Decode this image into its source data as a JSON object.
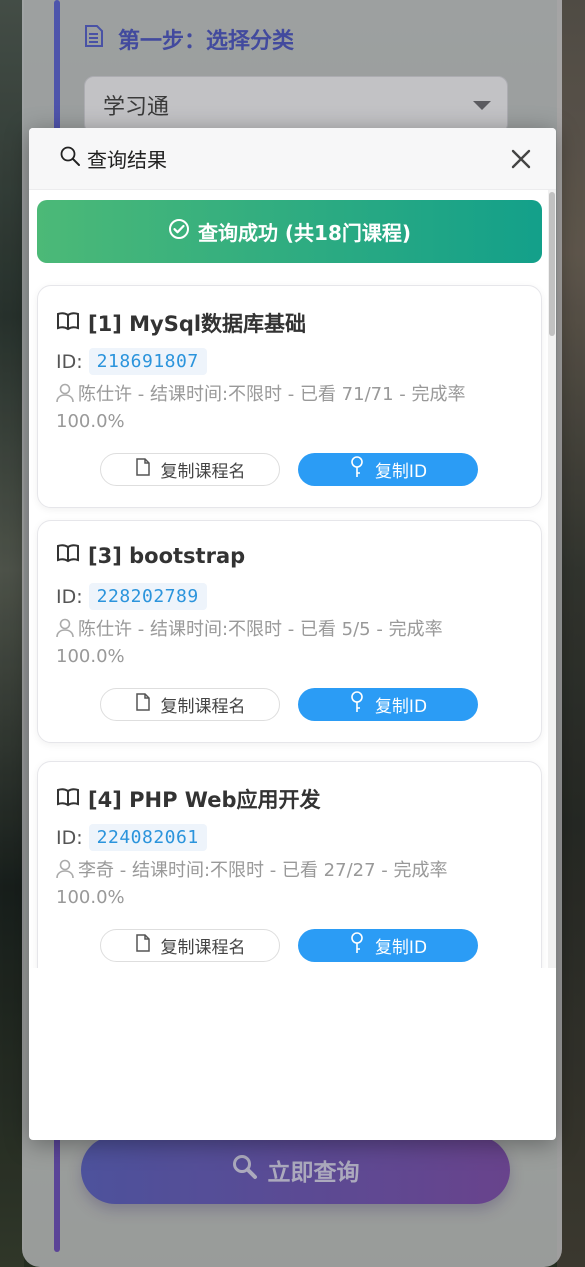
{
  "background": {
    "step_title": "第一步：选择分类",
    "select_value": "学习通",
    "query_button": "立即查询"
  },
  "modal": {
    "title": "查询结果",
    "success_text": "查询成功 (共18门课程)"
  },
  "labels": {
    "id_prefix": "ID:",
    "copy_name": "复制课程名",
    "copy_id": "复制ID"
  },
  "courses": [
    {
      "title": "[1] MySql数据库基础",
      "id": "218691807",
      "info": "陈仕许 - 结课时间:不限时 - 已看 71/71 - 完成率 100.0%"
    },
    {
      "title": "[3] bootstrap",
      "id": "228202789",
      "info": "陈仕许 - 结课时间:不限时 - 已看 5/5 - 完成率 100.0%"
    },
    {
      "title": "[4] PHP Web应用开发",
      "id": "224082061",
      "info": "李奇 - 结课时间:不限时 - 已看 27/27 - 完成率 100.0%"
    }
  ],
  "colors": {
    "accent": "#4d57b8",
    "success_start": "#4cb977",
    "success_end": "#13a08a",
    "id_blue": "#2b94dc",
    "copy_id_bg": "#2b9cf5"
  }
}
